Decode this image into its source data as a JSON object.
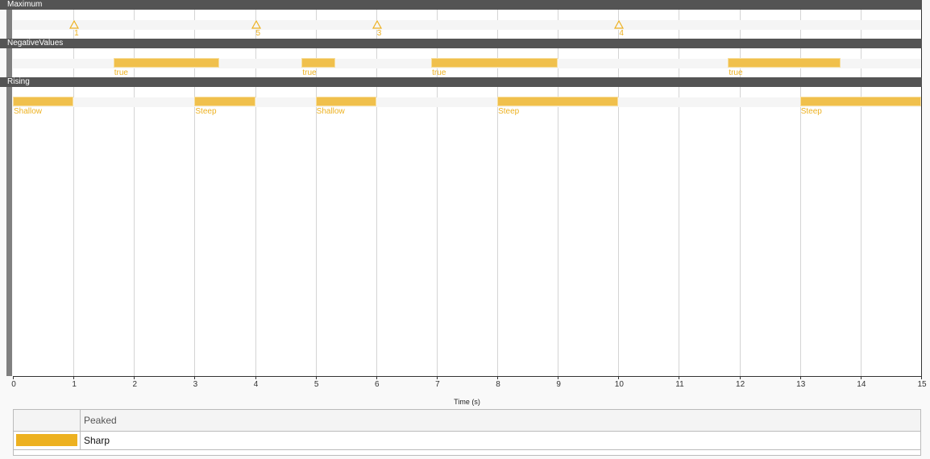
{
  "chart_data": {
    "type": "timeline",
    "xlabel": "Time (s)",
    "xlim": [
      0,
      15
    ],
    "xticks": [
      "0",
      "1",
      "2",
      "3",
      "4",
      "5",
      "6",
      "7",
      "8",
      "9",
      "10",
      "11",
      "12",
      "13",
      "14",
      "15"
    ],
    "grid": true,
    "color": "#edb120",
    "tracks": [
      {
        "name": "Maximum",
        "kind": "point",
        "points": [
          {
            "t": 1,
            "label": "1"
          },
          {
            "t": 4,
            "label": "5"
          },
          {
            "t": 6,
            "label": "3"
          },
          {
            "t": 10,
            "label": "4"
          }
        ]
      },
      {
        "name": "NegativeValues",
        "kind": "region",
        "regions": [
          {
            "start": 1.66,
            "end": 3.41,
            "label": "true"
          },
          {
            "start": 4.77,
            "end": 5.32,
            "label": "true"
          },
          {
            "start": 6.91,
            "end": 9.0,
            "label": "true"
          },
          {
            "start": 11.81,
            "end": 13.67,
            "label": "true"
          }
        ]
      },
      {
        "name": "Rising",
        "kind": "region",
        "regions": [
          {
            "start": 0,
            "end": 1,
            "label": "Shallow"
          },
          {
            "start": 3,
            "end": 4,
            "label": "Steep"
          },
          {
            "start": 5,
            "end": 6,
            "label": "Shallow"
          },
          {
            "start": 8,
            "end": 10,
            "label": "Steep"
          },
          {
            "start": 13,
            "end": 15,
            "label": "Steep"
          }
        ]
      }
    ]
  },
  "legend": {
    "header": "Peaked",
    "items": [
      {
        "label": "Sharp",
        "color": "#edb120"
      }
    ]
  }
}
